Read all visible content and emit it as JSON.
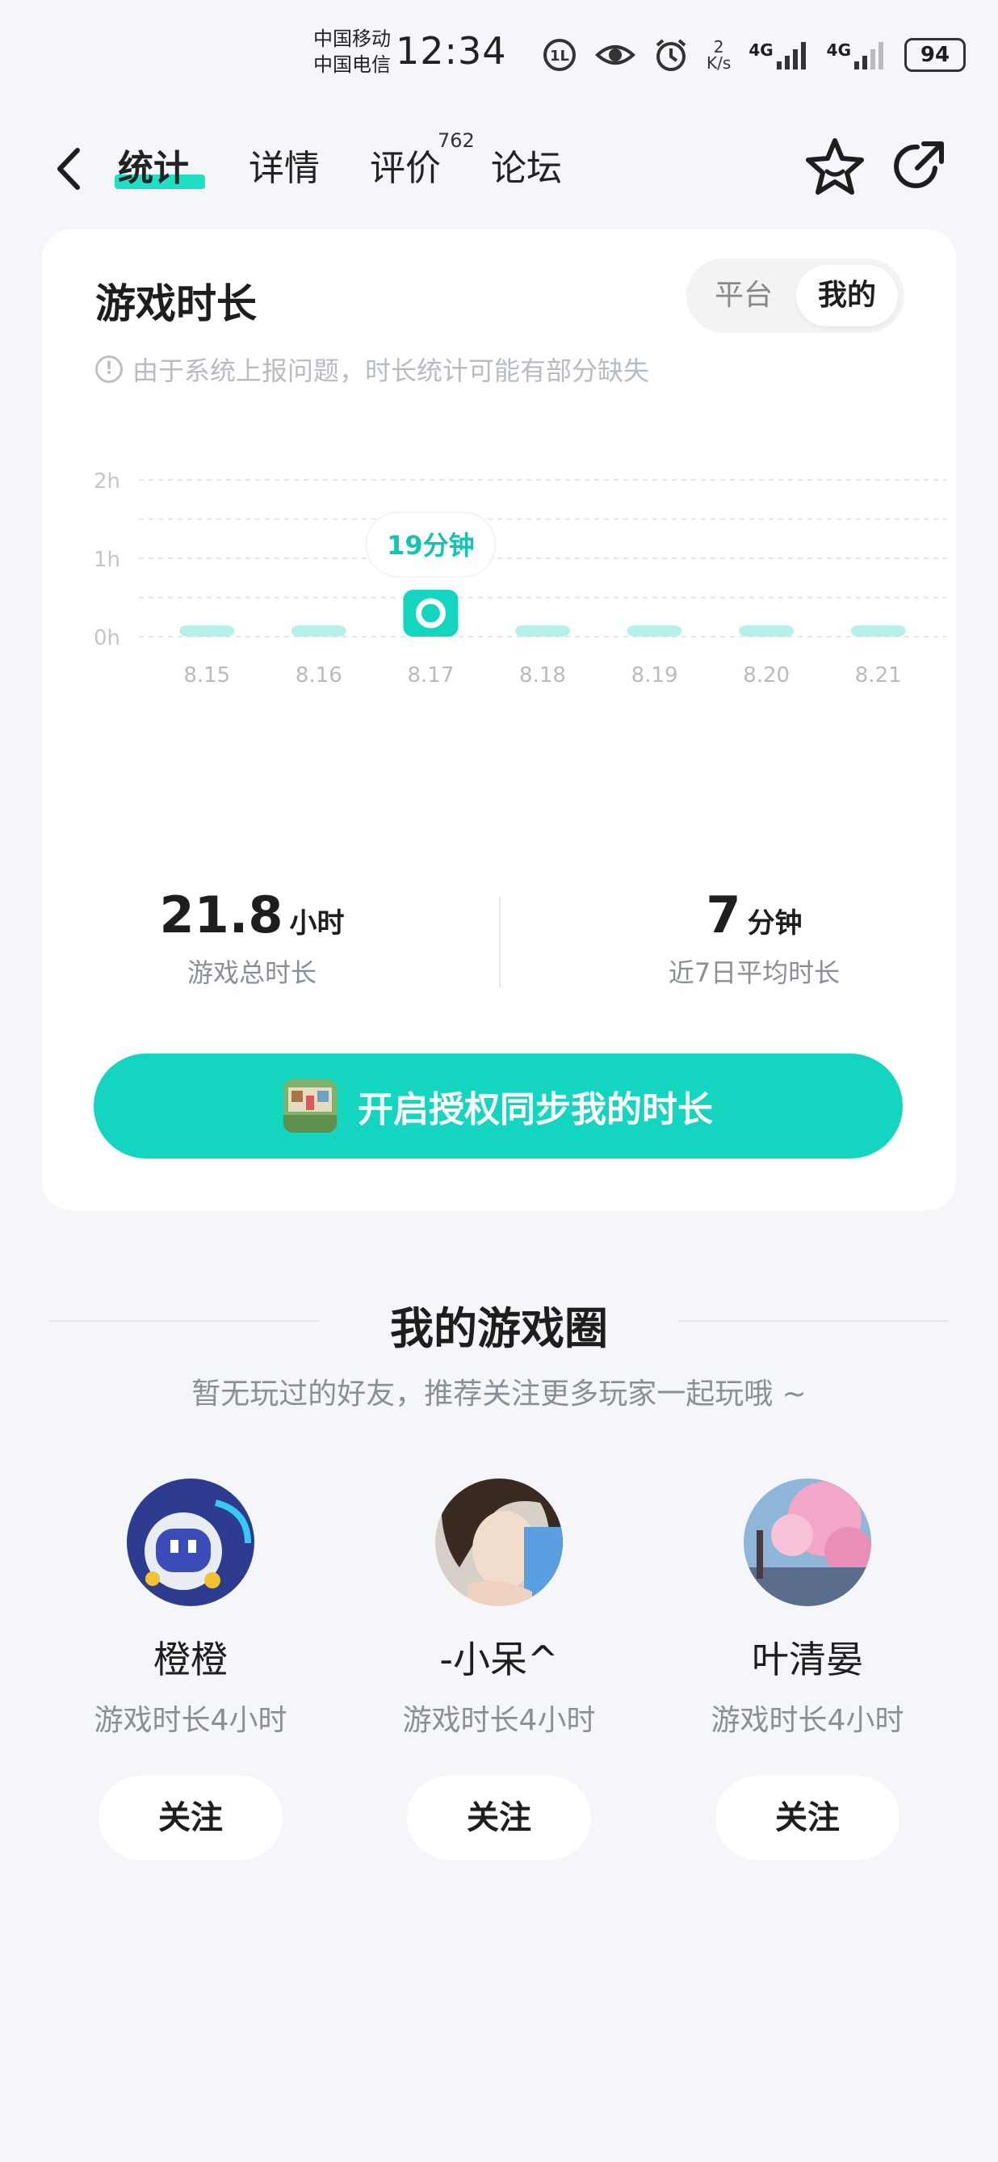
{
  "status_bar": {
    "carrier_1": "中国移动",
    "carrier_2": "中国电信",
    "time": "12:34",
    "net_speed_value": "2",
    "net_speed_unit": "K/s",
    "net_1": "4G",
    "net_2": "4G",
    "battery": "94"
  },
  "nav": {
    "tabs": [
      "统计",
      "详情",
      "评价",
      "论坛"
    ],
    "active_tab": "统计",
    "review_count": "762",
    "icons": [
      "back-arrow-icon",
      "star-icon",
      "share-icon"
    ]
  },
  "playtime_card": {
    "title": "游戏时长",
    "toggle": {
      "options": [
        "平台",
        "我的"
      ],
      "selected": "我的"
    },
    "notice": "由于系统上报问题，时长统计可能有部分缺失",
    "tooltip": "19分钟",
    "stats": [
      {
        "value": "21.8",
        "unit": "小时",
        "label": "游戏总时长"
      },
      {
        "value": "7",
        "unit": "分钟",
        "label": "近7日平均时长"
      }
    ],
    "sync_button": "开启授权同步我的时长"
  },
  "chart_data": {
    "type": "bar",
    "categories": [
      "8.15",
      "8.16",
      "8.17",
      "8.18",
      "8.19",
      "8.20",
      "8.21"
    ],
    "values": [
      0.13,
      0.05,
      0.32,
      0.12,
      0.08,
      0.05,
      0.1
    ],
    "y_tick_labels": [
      "0h",
      "1h",
      "2h"
    ],
    "ylim": [
      0,
      2
    ],
    "highlight_index": 2,
    "grid": true,
    "colors": {
      "bar": "#b5f0ea",
      "highlight": "#14d6c0",
      "tooltip_text": "#14c4b0"
    }
  },
  "friends_section": {
    "title": "我的游戏圈",
    "subtitle": "暂无玩过的好友，推荐关注更多玩家一起玩哦 ~",
    "players": [
      {
        "name": "橙橙",
        "playtime": "游戏时长4小时",
        "follow": "关注"
      },
      {
        "name": "-小呆^",
        "playtime": "游戏时长4小时",
        "follow": "关注"
      },
      {
        "name": "叶清晏",
        "playtime": "游戏时长4小时",
        "follow": "关注"
      }
    ]
  },
  "colors": {
    "accent": "#14d6c0",
    "background": "#f4f6f9"
  }
}
